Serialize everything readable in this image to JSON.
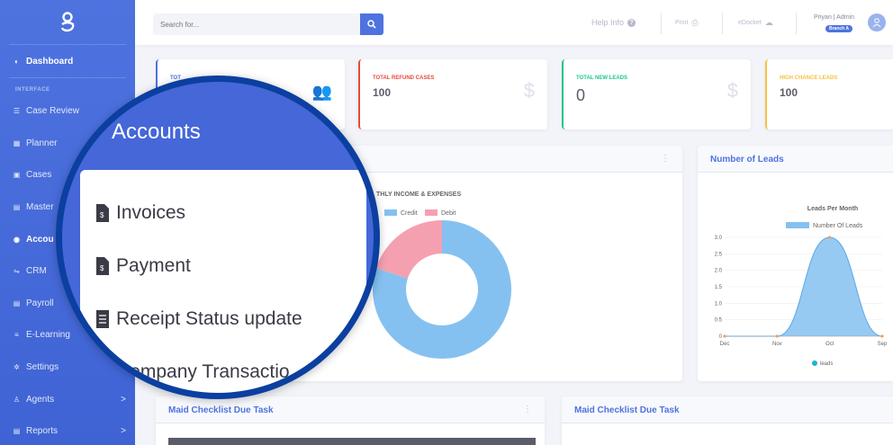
{
  "sidebar": {
    "section_interface": "INTERFACE",
    "items": [
      {
        "label": "Dashboard",
        "icon": "dashboard-icon"
      },
      {
        "label": "Case Review",
        "icon": "list-icon"
      },
      {
        "label": "Planner",
        "icon": "calendar-icon"
      },
      {
        "label": "Cases",
        "icon": "briefcase-icon"
      },
      {
        "label": "Master",
        "icon": "file-icon"
      },
      {
        "label": "Accou",
        "icon": "accounts-icon"
      },
      {
        "label": "CRM",
        "icon": "handshake-icon"
      },
      {
        "label": "Payroll",
        "icon": "file-icon"
      },
      {
        "label": "E-Learning",
        "icon": "book-icon"
      },
      {
        "label": "Settings",
        "icon": "gear-icon"
      },
      {
        "label": "Agents",
        "icon": "user-icon",
        "chevron": ">"
      },
      {
        "label": "Reports",
        "icon": "file-icon",
        "chevron": ">"
      }
    ]
  },
  "topbar": {
    "search_placeholder": "Search for...",
    "help_info": "Help Info",
    "print": "Print",
    "edocket": "eDocket",
    "user_name": "Priyan | Admin",
    "branch": "Branch A"
  },
  "stats": [
    {
      "label": "TOT",
      "value": "",
      "color": "#4e73df",
      "icon": "users-icon"
    },
    {
      "label": "TOTAL REFUND CASES",
      "value": "100",
      "color": "#e74a3b",
      "icon": "dollar-icon"
    },
    {
      "label": "TOTAL NEW LEADS",
      "value": "0",
      "color": "#1cc88a",
      "icon": "dollar-icon"
    },
    {
      "label": "HIGH CHANCE LEADS",
      "value": "100",
      "color": "#f6c23e",
      "icon": "dollar-icon"
    }
  ],
  "panels": {
    "income_title": "THLY INCOME & EXPENSES",
    "leads_title": "Number of Leads",
    "maid_left_title": "Maid Checklist Due Task",
    "maid_right_title": "Maid Checklist Due Task"
  },
  "chart_data": [
    {
      "type": "pie",
      "title": "THLY INCOME & EXPENSES",
      "legend": [
        "Credit",
        "Debit"
      ],
      "values": [
        80,
        20
      ],
      "colors": [
        "#85c1f0",
        "#f5a0b0"
      ],
      "legend_placement": "top"
    },
    {
      "type": "area",
      "title": "Leads Per Month",
      "series": [
        {
          "name": "Number Of Leads",
          "values": [
            0,
            0,
            3,
            0
          ]
        }
      ],
      "categories": [
        "Dec",
        "Nov",
        "Oct",
        "Sep"
      ],
      "yticks": [
        "0",
        "0.5",
        "1.0",
        "1.5",
        "2.0",
        "2.5",
        "3.0"
      ],
      "ylim": [
        0,
        3.0
      ],
      "bottom_legend": "leads",
      "color": "#85c1f0",
      "legend_placement": "top"
    }
  ],
  "magnifier": {
    "title": "Accounts",
    "items": [
      {
        "label": "Invoices",
        "icon": "invoice-doc-icon"
      },
      {
        "label": "Payment",
        "icon": "payment-doc-icon"
      },
      {
        "label": "Receipt Status update",
        "icon": "receipt-icon"
      },
      {
        "label": "Company Transactio",
        "icon": "receipt-icon"
      }
    ]
  }
}
